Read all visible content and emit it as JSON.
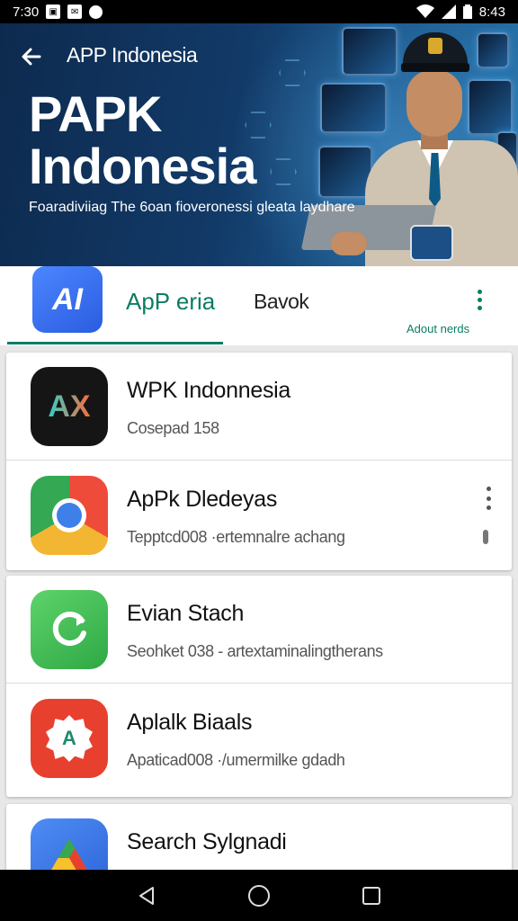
{
  "status_bar": {
    "time": "7:30",
    "clock_right": "8:43",
    "left_icons": [
      "gallery-icon",
      "notification-icon",
      "chat-icon"
    ],
    "right_icons": [
      "wifi-icon",
      "signal-icon",
      "battery-icon"
    ]
  },
  "header": {
    "back_icon": "back-arrow-icon",
    "title": "APP Indonesia",
    "big_title_line1": "PAPK",
    "big_title_line2": "Indonesia",
    "subtitle": "Foaradiviiag The 6oan fioveronessi gleata laydhare"
  },
  "panel": {
    "icon_text": "AI",
    "title": "ApP eria",
    "second_label": "Bavok",
    "small_label": "Adout nerds"
  },
  "apps": [
    {
      "title": "WPK Indonnesia",
      "subtitle": "Cosepad 158",
      "icon_text": "AX",
      "icon_name": "apk-logo-icon",
      "has_menu": false
    },
    {
      "title": "ApPk Dledeyas",
      "subtitle": "Tepptcd008 ·ertemnalre achang",
      "icon_text": "",
      "icon_name": "chrome-style-icon",
      "has_menu": true
    },
    {
      "title": "Evian Stach",
      "subtitle": "Seohket 038 - artextaminalingtherans",
      "icon_text": "",
      "icon_name": "refresh-icon",
      "has_menu": false
    },
    {
      "title": "Aplalk Biaals",
      "subtitle": "Apaticad008 ·/umermilke gdadh",
      "icon_text": "A",
      "icon_name": "badge-a-icon",
      "has_menu": false
    },
    {
      "title": "Search Sylgnadi",
      "subtitle": "",
      "icon_text": "",
      "icon_name": "drive-style-icon",
      "has_menu": false
    }
  ],
  "nav": {
    "back": "back-triangle-icon",
    "home": "home-circle-icon",
    "recents": "recents-square-icon"
  },
  "colors": {
    "accent": "#0b7d63",
    "hero_dark": "#0d2a4e",
    "hero_light": "#2b78b0"
  }
}
